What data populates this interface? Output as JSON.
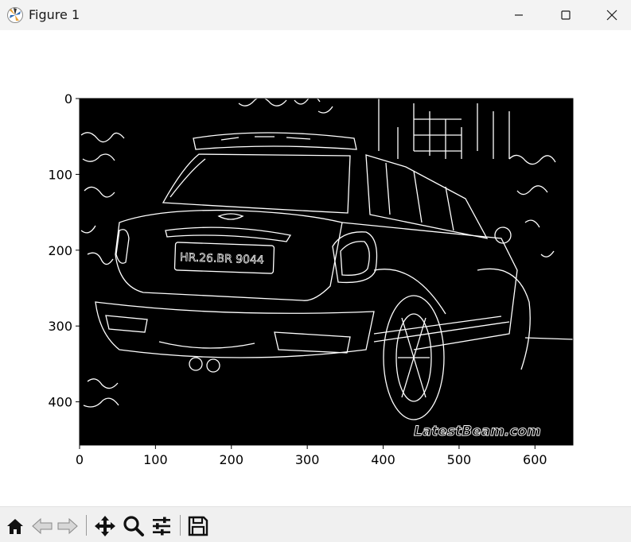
{
  "window": {
    "title": "Figure 1",
    "controls": [
      "minimize-icon",
      "maximize-icon",
      "close-icon"
    ]
  },
  "figure": {
    "image_description_label": "",
    "watermark_text": "LatestBeam.com",
    "plate_text": "HR.26.BR 9044",
    "x_ticks": [
      "0",
      "100",
      "200",
      "300",
      "400",
      "500",
      "600"
    ],
    "y_ticks": [
      "0",
      "100",
      "200",
      "300",
      "400"
    ],
    "x_range": [
      0,
      650
    ],
    "y_range": [
      0,
      457
    ],
    "image_background": "#000000",
    "edge_color": "#ffffff"
  },
  "toolbar": {
    "buttons": [
      "home-icon",
      "back-icon",
      "forward-icon",
      "pan-icon",
      "zoom-icon",
      "configure-subplots-icon",
      "save-icon"
    ]
  }
}
